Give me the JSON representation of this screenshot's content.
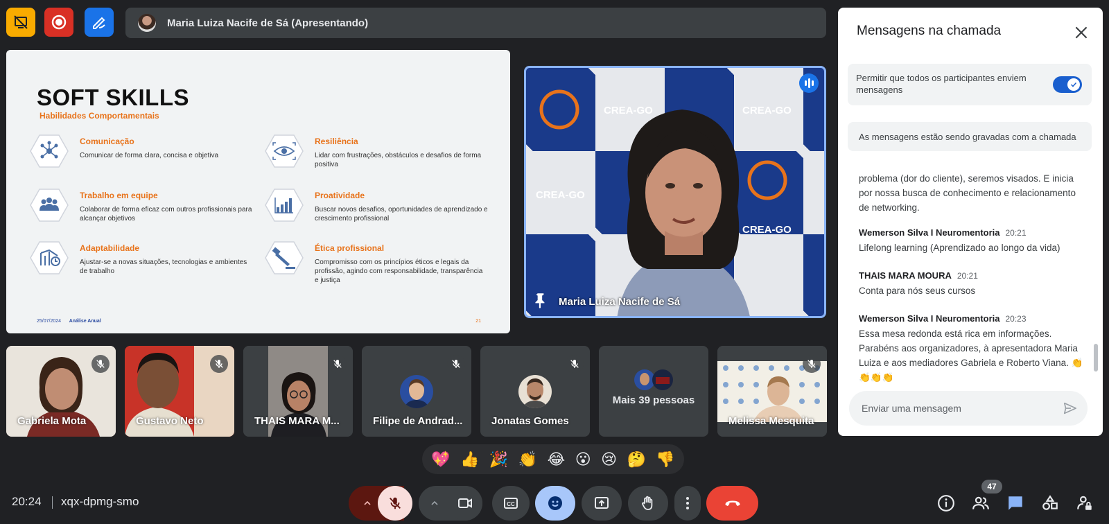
{
  "top_bar": {
    "presenter_label": "Maria Luiza Nacife de Sá (Apresentando)",
    "buttons": [
      {
        "icon": "slides-off-icon",
        "color": "#f9ab00"
      },
      {
        "icon": "record-icon",
        "color": "#d93025"
      },
      {
        "icon": "whiteboard-icon",
        "color": "#1a73e8"
      }
    ]
  },
  "slide": {
    "title": "SOFT SKILLS",
    "subtitle": "Habilidades Comportamentais",
    "skills": [
      {
        "name": "Comunicação",
        "desc": "Comunicar de forma clara, concisa e objetiva",
        "icon": "network-icon"
      },
      {
        "name": "Resiliência",
        "desc": "Lidar com frustrações, obstáculos e desafios de forma positiva",
        "icon": "eye-icon"
      },
      {
        "name": "Trabalho em equipe",
        "desc": "Colaborar de forma eficaz com outros profissionais para alcançar objetivos",
        "icon": "team-icon"
      },
      {
        "name": "Proatividade",
        "desc": "Buscar novos desafios, oportunidades de aprendizado e crescimento profissional",
        "icon": "growth-chart-icon"
      },
      {
        "name": "Adaptabilidade",
        "desc": "Ajustar-se a novas situações, tecnologias e ambientes de trabalho",
        "icon": "adapt-chart-icon"
      },
      {
        "name": "Ética profissional",
        "desc": "Compromisso com os princípios éticos e legais da profissão, agindo com responsabilidade, transparência e justiça",
        "icon": "gavel-icon"
      }
    ],
    "footer_date": "25/07/2024",
    "footer_brand": "Análise Anual",
    "page_number": "21"
  },
  "main_video": {
    "name": "Maria Luiza Nacife de Sá",
    "backdrop_text": "CREA-GO"
  },
  "participants": [
    {
      "name": "Gabriela Mota",
      "muted": true
    },
    {
      "name": "Gustavo Neto",
      "muted": true
    },
    {
      "name": "THAIS MARA M...",
      "muted": true
    },
    {
      "name": "Filipe de Andrad...",
      "muted": true
    },
    {
      "name": "Jonatas Gomes",
      "muted": true
    },
    {
      "name": "Mais 39 pessoas",
      "muted": false
    },
    {
      "name": "Melissa Mesquita",
      "muted": true
    }
  ],
  "reactions": [
    "💖",
    "👍",
    "🎉",
    "👏",
    "😂",
    "😮",
    "😢",
    "🤔",
    "👎"
  ],
  "bottom_bar": {
    "time": "20:24",
    "meeting_code": "xqx-dpmg-smo",
    "people_count": "47"
  },
  "chat": {
    "title": "Mensagens na chamada",
    "permission_text": "Permitir que todos os participantes enviem mensagens",
    "permission_on": true,
    "recording_notice": "As mensagens estão sendo gravadas com a chamada",
    "partial_message": "problema (dor do cliente), seremos visados. E inicia por nossa busca de conhecimento e relacionamento de networking.",
    "messages": [
      {
        "sender": "Wemerson Silva I Neuromentoria",
        "time": "20:21",
        "text": "Lifelong learning (Aprendizado ao longo da vida)"
      },
      {
        "sender": "THAIS MARA MOURA",
        "time": "20:21",
        "text": "Conta para nós seus cursos"
      },
      {
        "sender": "Wemerson Silva I Neuromentoria",
        "time": "20:23",
        "text": "Essa mesa redonda está rica em informações. Parabéns aos organizadores, à  apresentadora Maria Luiza e aos mediadores Gabriela e Roberto Viana. 👏👏👏👏"
      }
    ],
    "input_placeholder": "Enviar uma mensagem"
  },
  "colors": {
    "background": "#202124",
    "accent_blue": "#8ab4f8",
    "end_call": "#ea4335",
    "mic_off": "#f9dedc",
    "slide_orange": "#e8731b"
  }
}
